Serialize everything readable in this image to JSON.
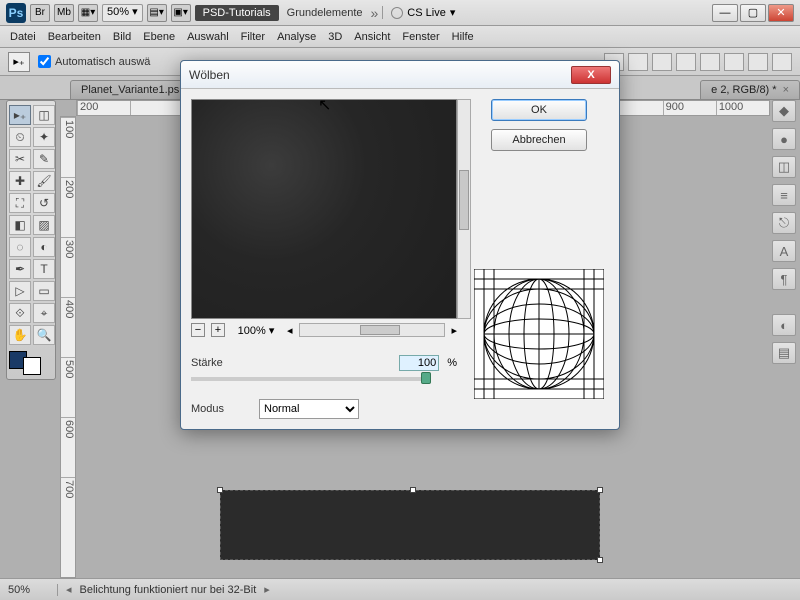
{
  "appbar": {
    "zoom": "50%",
    "pill": "PSD-Tutorials",
    "doc": "Grundelemente",
    "cslive": "CS Live"
  },
  "menu": [
    "Datei",
    "Bearbeiten",
    "Bild",
    "Ebene",
    "Auswahl",
    "Filter",
    "Analyse",
    "3D",
    "Ansicht",
    "Fenster",
    "Hilfe"
  ],
  "optbar": {
    "autosel": "Automatisch auswä"
  },
  "tab": {
    "left": "Planet_Variante1.ps",
    "right": "e 2, RGB/8) *"
  },
  "ruler_h": [
    "200",
    "",
    "",
    "",
    "",
    "",
    "",
    "900",
    "1000"
  ],
  "ruler_v": [
    "100",
    "200",
    "300",
    "400",
    "500",
    "600",
    "700"
  ],
  "status": {
    "zoom": "50%",
    "msg": "Belichtung funktioniert nur bei 32-Bit"
  },
  "dialog": {
    "title": "Wölben",
    "ok": "OK",
    "cancel": "Abbrechen",
    "zoom": "100%",
    "strength_label": "Stärke",
    "strength_val": "100",
    "pct": "%",
    "mode_label": "Modus",
    "mode_val": "Normal"
  }
}
